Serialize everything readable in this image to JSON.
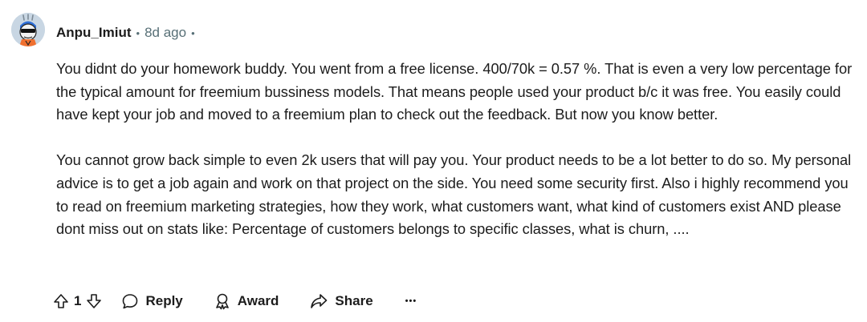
{
  "comment": {
    "author": "Anpu_Imiut",
    "age": "8d ago",
    "paragraphs": [
      "You didnt do your homework buddy. You went from a free license. 400/70k = 0.57 %. That is even a very low percentage for the typical amount for freemium bussiness models. That means people used your product b/c it was free. You easily could have kept your job and moved to a freemium plan to check out the feedback. But now you know better.",
      "You cannot grow back simple to even 2k users that will pay you. Your product needs to be a lot better to do so. My personal advice is to get a job again and work on that project on the side. You need some security first. Also i highly recommend you to read on freemium marketing strategies, how they work, what customers want, what kind of customers exist AND please dont miss out on stats like: Percentage of customers belongs to specific classes, what is churn, ...."
    ]
  },
  "actions": {
    "vote_count": "1",
    "reply_label": "Reply",
    "award_label": "Award",
    "share_label": "Share",
    "more_label": "•••"
  },
  "icons": {
    "upvote": "arrow-up-icon",
    "downvote": "arrow-down-icon",
    "reply": "speech-bubble-icon",
    "award": "award-ribbon-icon",
    "share": "share-arrow-icon",
    "more": "ellipsis-icon"
  },
  "colors": {
    "text": "#1c1c1c",
    "meta": "#576f76",
    "background": "#ffffff"
  }
}
